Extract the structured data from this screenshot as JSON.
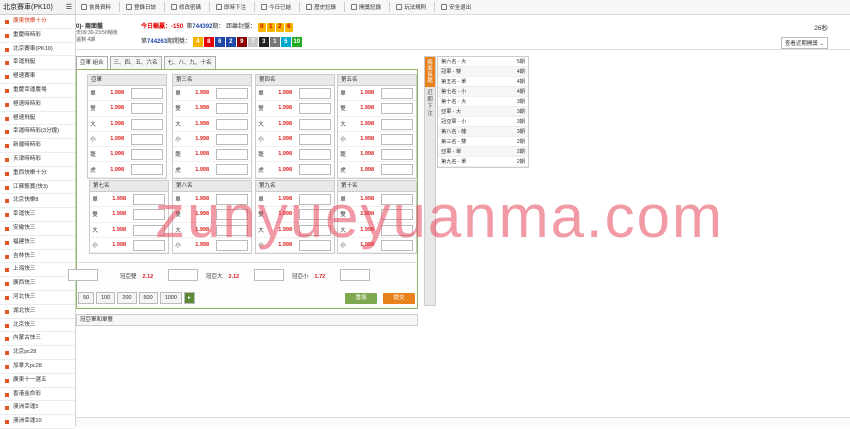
{
  "left": {
    "title": "北京賽車(PK10)",
    "items": [
      "重慶時時彩",
      "北京賽車(PK10)",
      "幸運飛艇",
      "極速賽車",
      "重慶幸運農場",
      "極速時時彩",
      "極速飛艇",
      "幸運時時彩(3分鐘)",
      "新疆時時彩",
      "天津時時彩",
      "重西快樂十分",
      "江蘇骰寶(快3)",
      "北京快樂8",
      "幸運快三",
      "安徽快三",
      "福建快三",
      "吉林快三",
      "上海快三",
      "廣西快三",
      "河北快三",
      "湖北快三",
      "北京快三",
      "內蒙古快三",
      "北京pc28",
      "加拿大pc28",
      "廣東十一選五",
      "香港金命彩",
      "澳洲幸運5",
      "澳洲幸運10"
    ],
    "active": "廣東快樂十分"
  },
  "toolbar": [
    "會員資料",
    "登錄日誌",
    "修改密碼",
    "即時下注",
    "今日已結",
    "歷史記錄",
    "開獎記錄",
    "玩法規則",
    "安全退出"
  ],
  "header": {
    "game_title": "0)- 兩面盤",
    "time_line1": "天09:30-23:50稍後",
    "time_line2": "還剩 4期",
    "today_label": "今日輸贏：",
    "today_value": "-150",
    "issue_prefix": "第",
    "issue": "744392",
    "issue_suffix": "期：",
    "close_label": "距離封盤：",
    "close_balls": [
      "0",
      "1",
      "2",
      "6"
    ],
    "seconds": "26秒",
    "prev_label": "第",
    "prev_issue": "744263",
    "prev_suffix": "期開獎：",
    "prev_numbers": [
      "4",
      "8",
      "6",
      "2",
      "9",
      "7",
      "3",
      "1",
      "5",
      "10"
    ],
    "select": "查看近期開獎"
  },
  "tabs": [
    "亞軍 組合",
    "三、四、五、六名",
    "七、八、九、十名"
  ],
  "groups": [
    {
      "title": "亞軍",
      "rows": [
        [
          "單",
          "1.998"
        ],
        [
          "雙",
          "1.998"
        ],
        [
          "大",
          "1.998"
        ],
        [
          "小",
          "1.998"
        ],
        [
          "龍",
          "1.998"
        ],
        [
          "虎",
          "1.998"
        ]
      ]
    },
    {
      "title": "第三名",
      "rows": [
        [
          "單",
          "1.998"
        ],
        [
          "雙",
          "1.998"
        ],
        [
          "大",
          "1.998"
        ],
        [
          "小",
          "1.998"
        ],
        [
          "龍",
          "1.998"
        ],
        [
          "虎",
          "1.998"
        ]
      ]
    },
    {
      "title": "第四名",
      "rows": [
        [
          "單",
          "1.998"
        ],
        [
          "雙",
          "1.998"
        ],
        [
          "大",
          "1.998"
        ],
        [
          "小",
          "1.998"
        ],
        [
          "龍",
          "1.998"
        ],
        [
          "虎",
          "1.998"
        ]
      ]
    },
    {
      "title": "第五名",
      "rows": [
        [
          "單",
          "1.998"
        ],
        [
          "雙",
          "1.998"
        ],
        [
          "大",
          "1.998"
        ],
        [
          "小",
          "1.998"
        ],
        [
          "龍",
          "1.998"
        ],
        [
          "虎",
          "1.998"
        ]
      ]
    },
    {
      "title": "第七名",
      "rows": [
        [
          "單",
          "1.998"
        ],
        [
          "雙",
          "1.998"
        ],
        [
          "大",
          "1.998"
        ],
        [
          "小",
          "1.998"
        ]
      ]
    },
    {
      "title": "第八名",
      "rows": [
        [
          "單",
          "1.998"
        ],
        [
          "雙",
          "1.998"
        ],
        [
          "大",
          "1.998"
        ],
        [
          "小",
          "1.998"
        ]
      ]
    },
    {
      "title": "第九名",
      "rows": [
        [
          "單",
          "1.998"
        ],
        [
          "雙",
          "1.998"
        ],
        [
          "大",
          "1.998"
        ],
        [
          "小",
          "1.998"
        ]
      ]
    },
    {
      "title": "第十名",
      "rows": [
        [
          "單",
          "1.998"
        ],
        [
          "雙",
          "1.998"
        ],
        [
          "大",
          "1.998"
        ],
        [
          "小",
          "1.998"
        ]
      ]
    }
  ],
  "combos": [
    {
      "label": "冠亞雙",
      "odds": "2.12"
    },
    {
      "label": "冠亞大",
      "odds": "2.12"
    },
    {
      "label": "冠亞小",
      "odds": "1.72"
    }
  ],
  "chips": [
    "50",
    "100",
    "200",
    "500",
    "1000"
  ],
  "buttons": {
    "reset": "重填",
    "submit": "提交"
  },
  "bar2": "冠亞軍和單雙",
  "side": {
    "top": "兩面長龍",
    "bottom": "近期下注"
  },
  "long": [
    [
      "第六名 - 大",
      "5期"
    ],
    [
      "冠軍 - 雙",
      "4期"
    ],
    [
      "第五名 - 單",
      "4期"
    ],
    [
      "第七名 - 小",
      "4期"
    ],
    [
      "第十名 - 大",
      "3期"
    ],
    [
      "亞軍 - 大",
      "3期"
    ],
    [
      "冠亞軍 - 小",
      "3期"
    ],
    [
      "第八名 - 龍",
      "3期"
    ],
    [
      "第三名 - 雙",
      "2期"
    ],
    [
      "亞軍 - 單",
      "2期"
    ],
    [
      "第九名 - 單",
      "2期"
    ]
  ],
  "watermark": "zunyueyuanma.com",
  "colors": {
    "ball_colors": [
      "#f7b400",
      "#e60000",
      "#1f47a5",
      "#1f47a5",
      "#8b0000",
      "#c9c9c9",
      "#222222",
      "#777777",
      "#00aacc",
      "#22aa22"
    ]
  }
}
